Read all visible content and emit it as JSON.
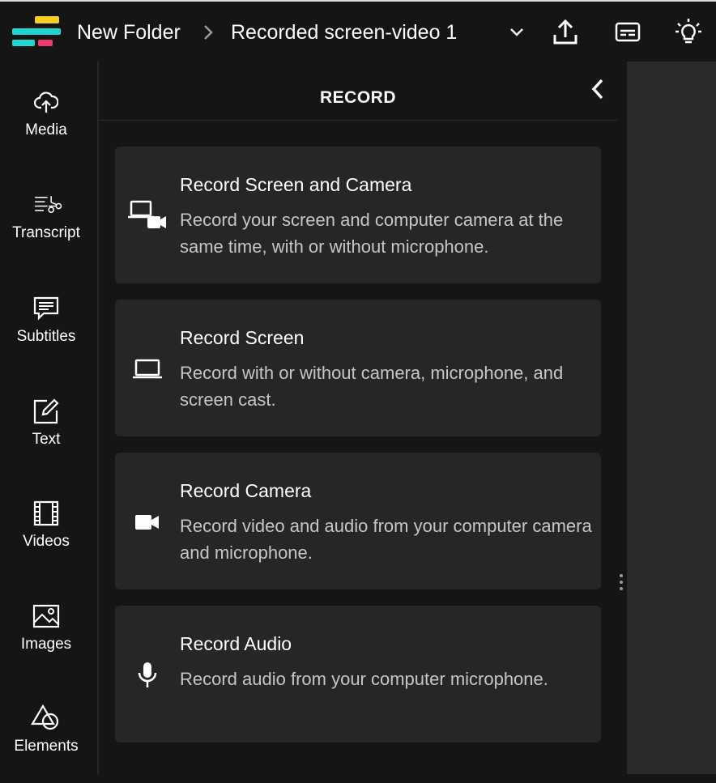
{
  "header": {
    "breadcrumb_folder": "New Folder",
    "project_title": "Recorded screen-video 1",
    "icons": [
      "logo",
      "chevron-right-icon",
      "chevron-down-icon",
      "upload-icon",
      "subtitles-icon",
      "lightbulb-icon"
    ]
  },
  "sidebar": {
    "items": [
      {
        "label": "Media",
        "icon": "cloud-upload-icon"
      },
      {
        "label": "Transcript",
        "icon": "transcript-icon"
      },
      {
        "label": "Subtitles",
        "icon": "speech-bubble-icon"
      },
      {
        "label": "Text",
        "icon": "edit-text-icon"
      },
      {
        "label": "Videos",
        "icon": "film-icon"
      },
      {
        "label": "Images",
        "icon": "image-icon"
      },
      {
        "label": "Elements",
        "icon": "shapes-icon"
      }
    ]
  },
  "panel": {
    "title": "RECORD",
    "cards": [
      {
        "title": "Record Screen and Camera",
        "description": "Record your screen and computer camera at the same time, with or without microphone.",
        "icon": "screen-camera-icon"
      },
      {
        "title": "Record Screen",
        "description": "Record with or without camera, microphone, and screen cast.",
        "icon": "laptop-icon"
      },
      {
        "title": "Record Camera",
        "description": "Record video and audio from your computer camera and microphone.",
        "icon": "video-camera-icon"
      },
      {
        "title": "Record Audio",
        "description": "Record audio from your computer microphone.",
        "icon": "microphone-icon"
      }
    ]
  },
  "colors": {
    "background": "#151515",
    "card": "#262626",
    "description_text": "#c6c6c6",
    "logo_yellow": "#f5d020",
    "logo_cyan": "#1fd6d0",
    "logo_pink": "#ee3b6e"
  }
}
